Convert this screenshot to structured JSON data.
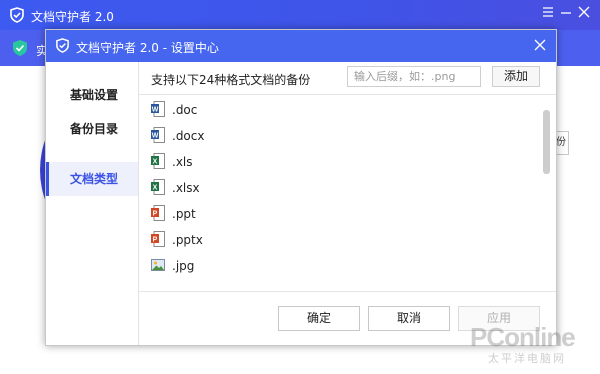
{
  "app": {
    "title": "文档守护者 2.0",
    "banner_text": "实",
    "side_button": "份"
  },
  "dialog": {
    "title": "文档守护者 2.0 - 设置中心",
    "nav": [
      {
        "label": "基础设置",
        "active": false
      },
      {
        "label": "备份目录",
        "active": false
      },
      {
        "label": "文档类型",
        "active": true
      }
    ],
    "description": "支持以下24种格式文档的备份",
    "search_placeholder": "输入后缀，如：.png",
    "add_label": "添加",
    "files": [
      {
        "ext": ".doc",
        "icon": "word-icon"
      },
      {
        "ext": ".docx",
        "icon": "word-icon"
      },
      {
        "ext": ".xls",
        "icon": "excel-icon"
      },
      {
        "ext": ".xlsx",
        "icon": "excel-icon"
      },
      {
        "ext": ".ppt",
        "icon": "powerpoint-icon"
      },
      {
        "ext": ".pptx",
        "icon": "powerpoint-icon"
      },
      {
        "ext": ".jpg",
        "icon": "image-icon"
      }
    ],
    "buttons": {
      "confirm": "确定",
      "cancel": "取消",
      "apply": "应用"
    }
  },
  "watermark": {
    "brand": "PConline",
    "sub": "太平洋电脑网"
  },
  "colors": {
    "accent": "#4766ef",
    "app_titlebar": "#3d5af1",
    "word": "#2b579a",
    "excel": "#217346",
    "powerpoint": "#d24726"
  }
}
